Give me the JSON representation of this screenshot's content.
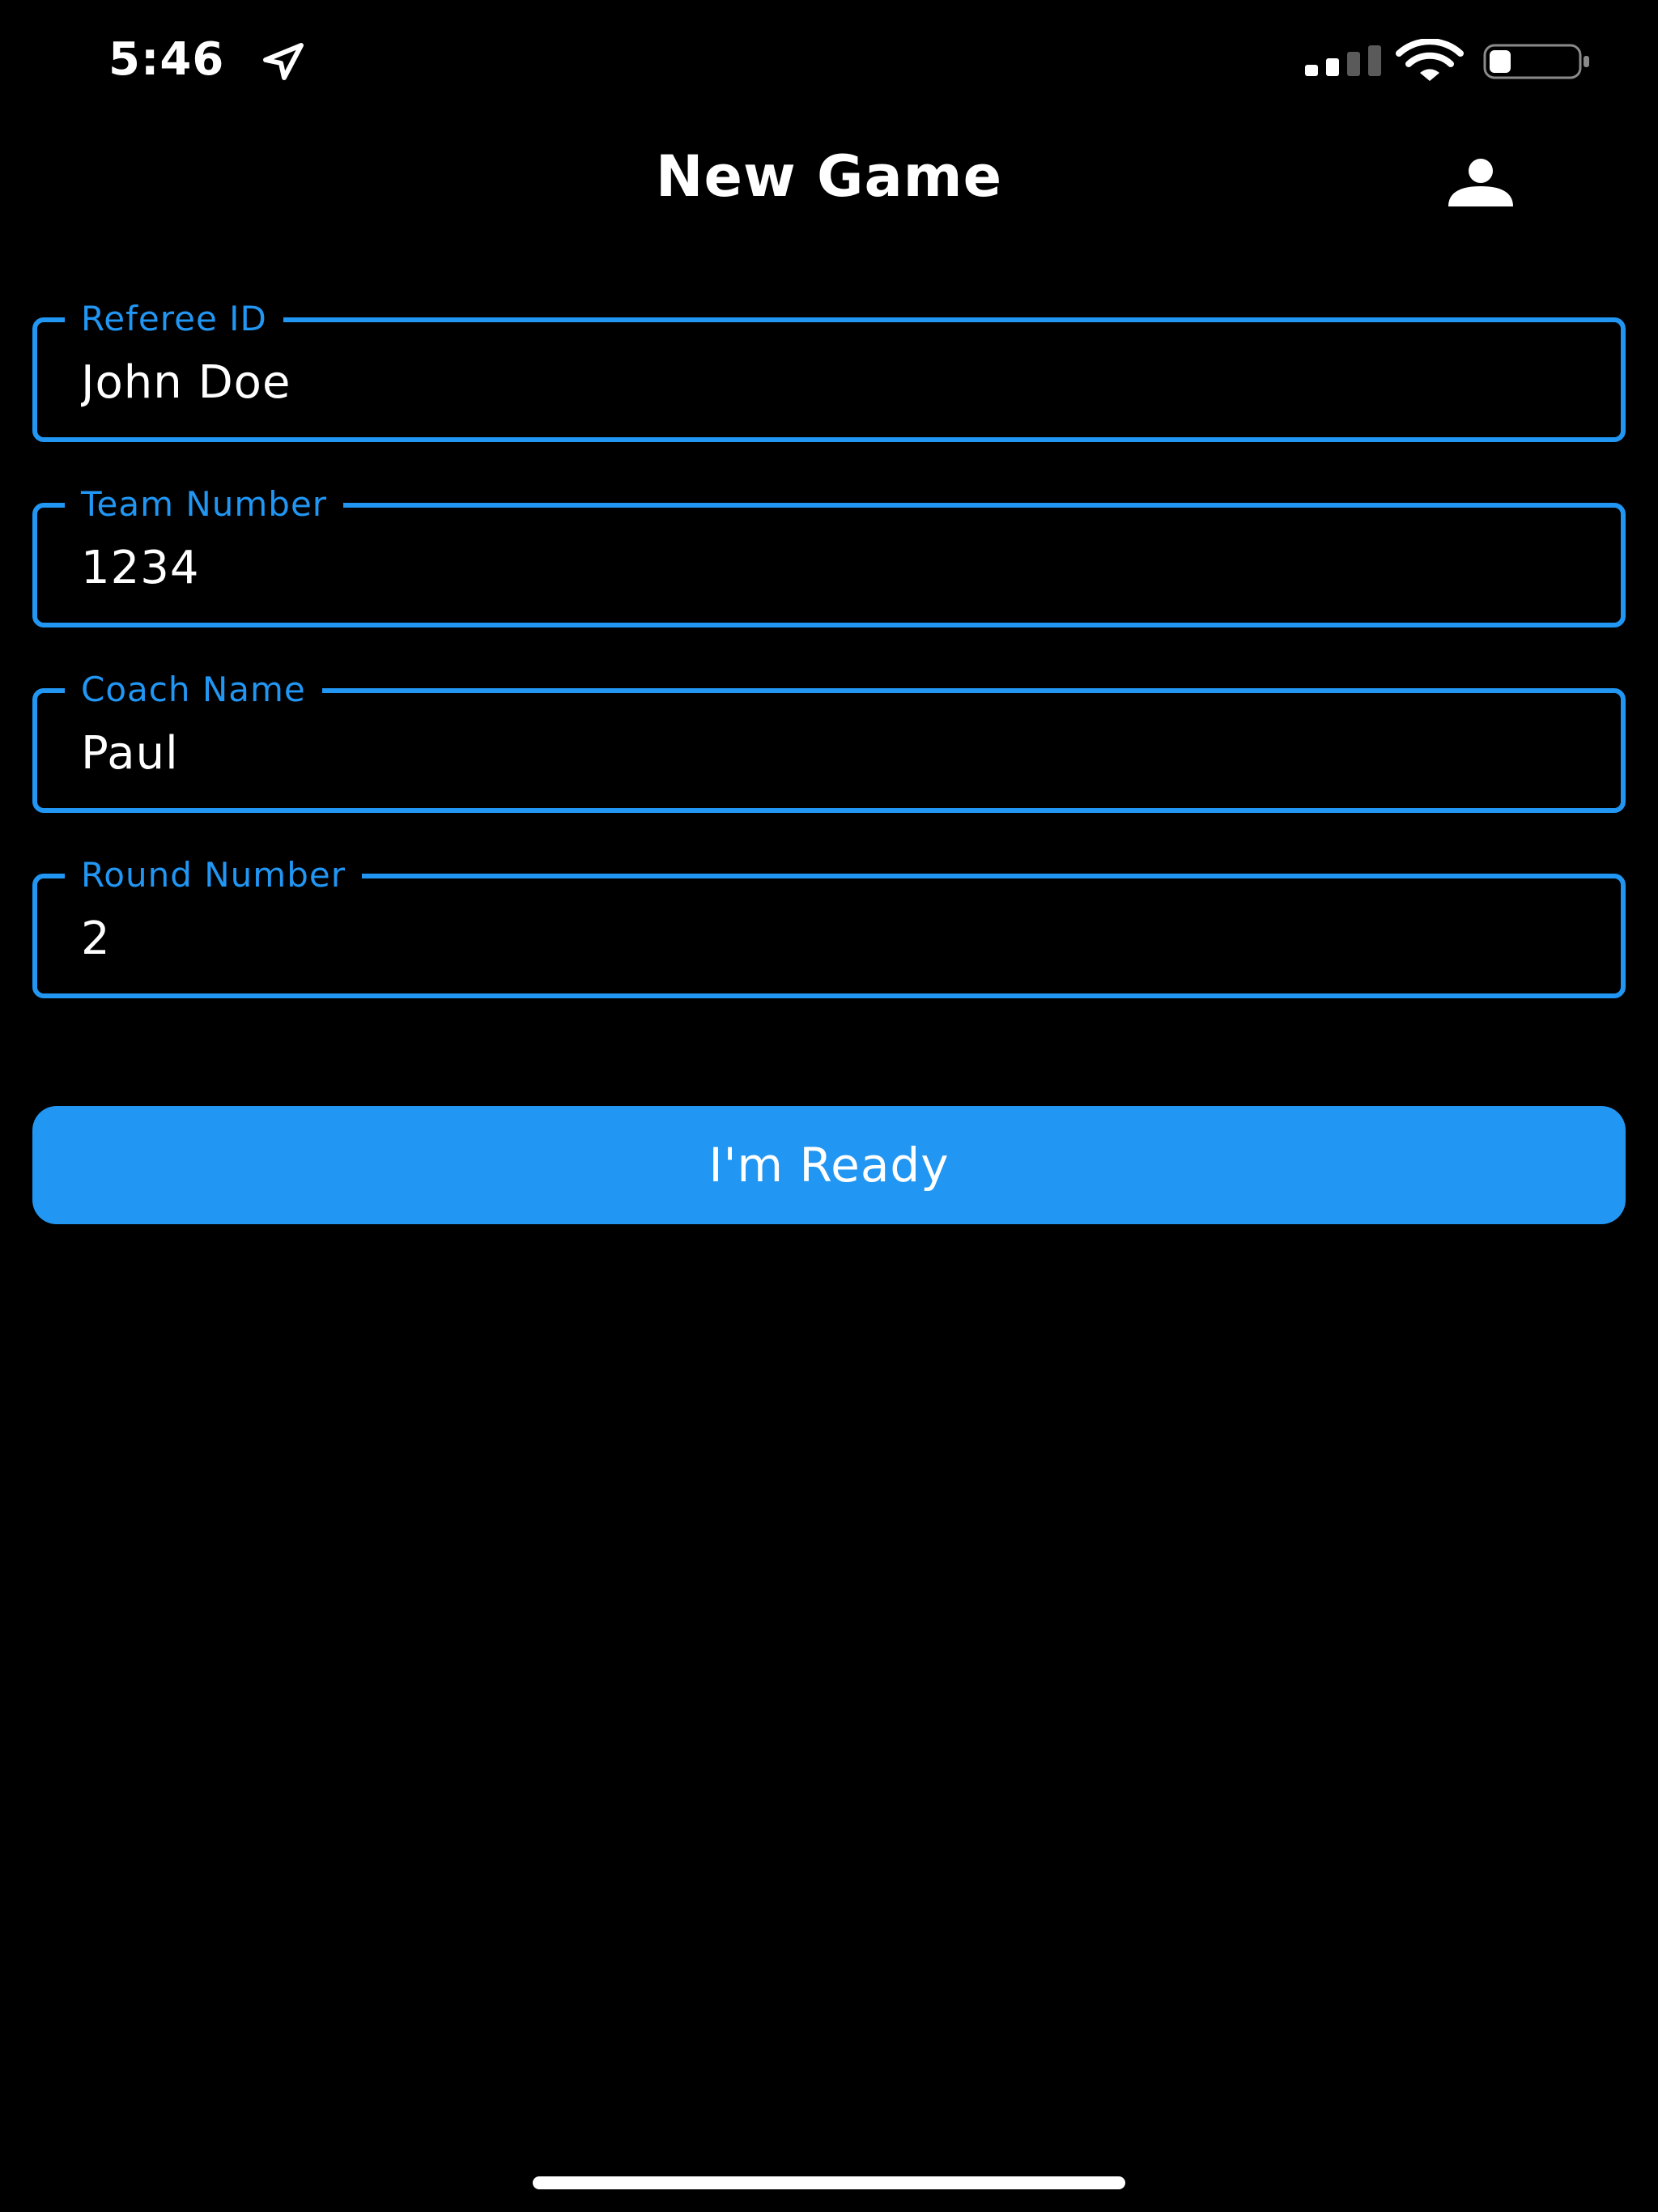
{
  "status_bar": {
    "time": "5:46",
    "icons": [
      "location-arrow-icon",
      "cellular-signal-icon",
      "wifi-icon",
      "battery-icon"
    ]
  },
  "nav": {
    "title": "New Game",
    "profile_icon": "person-icon"
  },
  "form": {
    "fields": [
      {
        "label": "Referee ID",
        "value": "John Doe"
      },
      {
        "label": "Team Number",
        "value": "1234"
      },
      {
        "label": "Coach Name",
        "value": "Paul"
      },
      {
        "label": "Round Number",
        "value": "2"
      }
    ]
  },
  "actions": {
    "ready_label": "I'm Ready"
  },
  "colors": {
    "background": "#000000",
    "accent": "#2196F3",
    "text": "#FFFFFF"
  }
}
